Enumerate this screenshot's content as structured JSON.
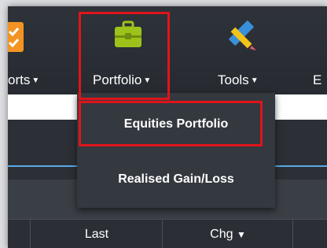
{
  "nav": {
    "reports_label": "orts",
    "portfolio_label": "Portfolio",
    "tools_label": "Tools",
    "next_label": "E"
  },
  "dropdown": {
    "items": [
      {
        "label": "Equities Portfolio"
      },
      {
        "label": "Realised Gain/Loss"
      }
    ]
  },
  "table": {
    "columns": [
      "Last",
      "Chg"
    ]
  },
  "colors": {
    "highlight": "#e0141b",
    "accent_blue": "#5aa9e6",
    "briefcase_green": "#9dc31a",
    "reports_orange": "#f29423"
  }
}
